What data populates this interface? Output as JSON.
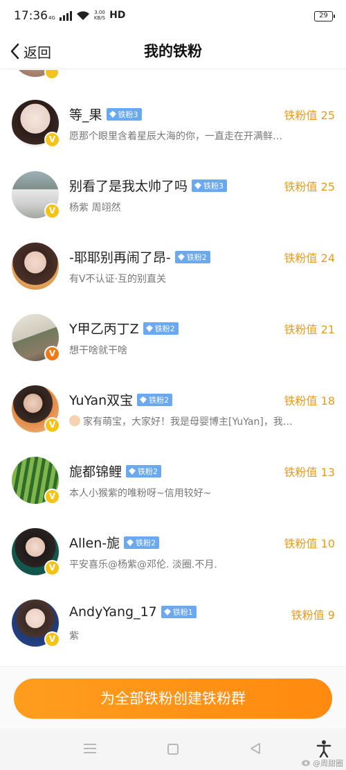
{
  "status_bar": {
    "time": "17:36",
    "network": "4G",
    "speed_value": "3.00",
    "speed_unit": "KB/S",
    "hd": "HD",
    "battery": "29"
  },
  "nav": {
    "back_label": "返回",
    "title": "我的铁粉"
  },
  "fans": [
    {
      "name": "等_果",
      "tag": "铁粉3",
      "score": "铁粉值 25",
      "desc": "愿那个眼里含着星辰大海的你，一直走在开满鲜…",
      "badge": "gold"
    },
    {
      "name": "别看了是我太帅了吗",
      "tag": "铁粉3",
      "score": "铁粉值 25",
      "desc": "杨紫 周翊然",
      "badge": "gold"
    },
    {
      "name": "-耶耶别再闹了昂-",
      "tag": "铁粉2",
      "score": "铁粉值 24",
      "desc": "有V不认证·互的别直关",
      "badge": "none"
    },
    {
      "name": "Y甲乙丙丁Z",
      "tag": "铁粉2",
      "score": "铁粉值 21",
      "desc": "想干啥就干啥",
      "badge": "orange"
    },
    {
      "name": "YuYan双宝",
      "tag": "铁粉2",
      "score": "铁粉值 18",
      "desc": "家有萌宝，大家好！我是母婴博主[YuYan]，我…",
      "badge": "gold"
    },
    {
      "name": "旎都锦鲤",
      "tag": "铁粉2",
      "score": "铁粉值 13",
      "desc": "本人小猴紫的唯粉呀~信用较好~",
      "badge": "gold"
    },
    {
      "name": "Allen-旎",
      "tag": "铁粉2",
      "score": "铁粉值 10",
      "desc": "平安喜乐@杨紫@邓伦. 淡圈.不月.",
      "badge": "gold"
    },
    {
      "name": "AndyYang_17",
      "tag": "铁粉1",
      "score": "铁粉值 9",
      "desc": "紫",
      "badge": "gold"
    }
  ],
  "badge_letter": "V",
  "create_button": "为全部铁粉创建铁粉群",
  "watermark": "@周甜圈",
  "colors": {
    "score": "#e89a1c",
    "tag": "#6aa8f0",
    "button": "#ff9414",
    "badge_gold": "#f4c316",
    "badge_orange": "#f07a14"
  }
}
